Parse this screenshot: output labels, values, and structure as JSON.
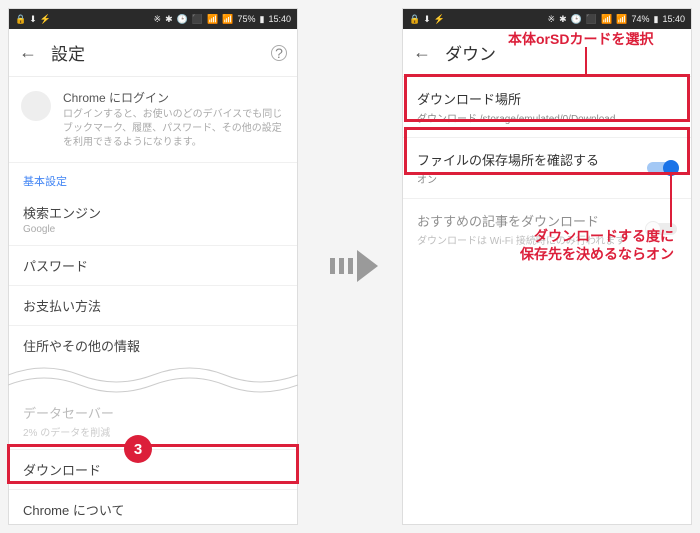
{
  "statusbar": {
    "battery": "75%",
    "battery2": "74%",
    "time": "15:40"
  },
  "left": {
    "title": "設定",
    "signin_title": "Chrome にログイン",
    "signin_desc": "ログインすると、お使いのどのデバイスでも同じブックマーク、履歴、パスワード、その他の設定を利用できるようになります。",
    "section_basic": "基本設定",
    "rows": {
      "search": "検索エンジン",
      "search_sub": "Google",
      "password": "パスワード",
      "payment": "お支払い方法",
      "address": "住所やその他の情報",
      "datasaver": "データセーバー",
      "datasaver_sub": "2% のデータを削減",
      "download": "ダウンロード",
      "about": "Chrome について"
    },
    "badge": "3"
  },
  "right": {
    "title": "ダウン",
    "rows": {
      "location": "ダウンロード場所",
      "location_sub": "ダウンロード /storage/emulated/0/Download",
      "ask": "ファイルの保存場所を確認する",
      "ask_sub": "オン",
      "articles": "おすすめの記事をダウンロード",
      "articles_sub": "ダウンロードは Wi-Fi 接続時にのみ行われます"
    }
  },
  "annotations": {
    "top": "本体orSDカードを選択",
    "side": "ダウンロードする度に\n保存先を決めるならオン"
  }
}
